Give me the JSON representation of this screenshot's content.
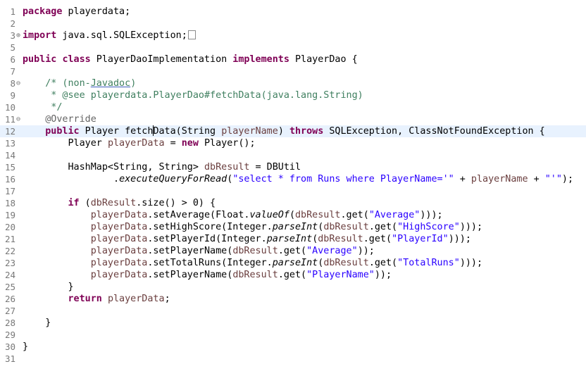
{
  "editor": {
    "current_line": 12,
    "lines": [
      {
        "n": "1",
        "fold": "",
        "tokens": [
          {
            "t": "package",
            "c": "kw"
          },
          {
            "t": " playerdata;"
          }
        ]
      },
      {
        "n": "2",
        "fold": "",
        "tokens": []
      },
      {
        "n": "3",
        "fold": "⊕",
        "tokens": [
          {
            "t": "import",
            "c": "kw"
          },
          {
            "t": " java.sql.SQLException;"
          },
          {
            "box": true
          }
        ]
      },
      {
        "n": "5",
        "fold": "",
        "tokens": []
      },
      {
        "n": "6",
        "fold": "",
        "tokens": [
          {
            "t": "public",
            "c": "kw"
          },
          {
            "t": " "
          },
          {
            "t": "class",
            "c": "kw"
          },
          {
            "t": " PlayerDaoImplementation "
          },
          {
            "t": "implements",
            "c": "kw"
          },
          {
            "t": " PlayerDao {"
          }
        ]
      },
      {
        "n": "7",
        "fold": "",
        "tokens": []
      },
      {
        "n": "8",
        "fold": "⊖",
        "tokens": [
          {
            "t": "    "
          },
          {
            "t": "/* (non-",
            "c": "cm"
          },
          {
            "t": "Javadoc",
            "c": "cm ul"
          },
          {
            "t": ")",
            "c": "cm"
          }
        ]
      },
      {
        "n": "9",
        "fold": "",
        "tokens": [
          {
            "t": "     * @see playerdata.PlayerDao#fetchData(java.lang.String)",
            "c": "cm"
          }
        ]
      },
      {
        "n": "10",
        "fold": "",
        "tokens": [
          {
            "t": "     */",
            "c": "cm"
          }
        ]
      },
      {
        "n": "11",
        "fold": "⊖",
        "tokens": [
          {
            "t": "    "
          },
          {
            "t": "@Override",
            "c": "ann"
          }
        ]
      },
      {
        "n": "12",
        "fold": "",
        "tokens": [
          {
            "t": "    "
          },
          {
            "t": "public",
            "c": "kw"
          },
          {
            "t": " Player fetch"
          },
          {
            "caret": true
          },
          {
            "t": "Data(String "
          },
          {
            "t": "playerName",
            "c": "fld"
          },
          {
            "t": ") "
          },
          {
            "t": "throws",
            "c": "kw"
          },
          {
            "t": " SQLException, ClassNotFoundException {"
          }
        ]
      },
      {
        "n": "13",
        "fold": "",
        "tokens": [
          {
            "t": "        Player "
          },
          {
            "t": "playerData",
            "c": "fld"
          },
          {
            "t": " = "
          },
          {
            "t": "new",
            "c": "kw"
          },
          {
            "t": " Player();"
          }
        ]
      },
      {
        "n": "14",
        "fold": "",
        "tokens": []
      },
      {
        "n": "15",
        "fold": "",
        "tokens": [
          {
            "t": "        HashMap<String, String> "
          },
          {
            "t": "dbResult",
            "c": "fld"
          },
          {
            "t": " = DBUtil"
          }
        ]
      },
      {
        "n": "16",
        "fold": "",
        "tokens": [
          {
            "t": "                ."
          },
          {
            "t": "executeQueryForRead",
            "c": "it"
          },
          {
            "t": "("
          },
          {
            "t": "\"select * from Runs where PlayerName='\"",
            "c": "str"
          },
          {
            "t": " + "
          },
          {
            "t": "playerName",
            "c": "fld"
          },
          {
            "t": " + "
          },
          {
            "t": "\"'\"",
            "c": "str"
          },
          {
            "t": ");"
          }
        ]
      },
      {
        "n": "17",
        "fold": "",
        "tokens": []
      },
      {
        "n": "18",
        "fold": "",
        "tokens": [
          {
            "t": "        "
          },
          {
            "t": "if",
            "c": "kw"
          },
          {
            "t": " ("
          },
          {
            "t": "dbResult",
            "c": "fld"
          },
          {
            "t": ".size() > 0) {"
          }
        ]
      },
      {
        "n": "19",
        "fold": "",
        "tokens": [
          {
            "t": "            "
          },
          {
            "t": "playerData",
            "c": "fld"
          },
          {
            "t": ".setAverage(Float."
          },
          {
            "t": "valueOf",
            "c": "it"
          },
          {
            "t": "("
          },
          {
            "t": "dbResult",
            "c": "fld"
          },
          {
            "t": ".get("
          },
          {
            "t": "\"Average\"",
            "c": "str"
          },
          {
            "t": ")));"
          }
        ]
      },
      {
        "n": "20",
        "fold": "",
        "tokens": [
          {
            "t": "            "
          },
          {
            "t": "playerData",
            "c": "fld"
          },
          {
            "t": ".setHighScore(Integer."
          },
          {
            "t": "parseInt",
            "c": "it"
          },
          {
            "t": "("
          },
          {
            "t": "dbResult",
            "c": "fld"
          },
          {
            "t": ".get("
          },
          {
            "t": "\"HighScore\"",
            "c": "str"
          },
          {
            "t": ")));"
          }
        ]
      },
      {
        "n": "21",
        "fold": "",
        "tokens": [
          {
            "t": "            "
          },
          {
            "t": "playerData",
            "c": "fld"
          },
          {
            "t": ".setPlayerId(Integer."
          },
          {
            "t": "parseInt",
            "c": "it"
          },
          {
            "t": "("
          },
          {
            "t": "dbResult",
            "c": "fld"
          },
          {
            "t": ".get("
          },
          {
            "t": "\"PlayerId\"",
            "c": "str"
          },
          {
            "t": ")));"
          }
        ]
      },
      {
        "n": "22",
        "fold": "",
        "tokens": [
          {
            "t": "            "
          },
          {
            "t": "playerData",
            "c": "fld"
          },
          {
            "t": ".setPlayerName("
          },
          {
            "t": "dbResult",
            "c": "fld"
          },
          {
            "t": ".get("
          },
          {
            "t": "\"Average\"",
            "c": "str"
          },
          {
            "t": "));"
          }
        ]
      },
      {
        "n": "23",
        "fold": "",
        "tokens": [
          {
            "t": "            "
          },
          {
            "t": "playerData",
            "c": "fld"
          },
          {
            "t": ".setTotalRuns(Integer."
          },
          {
            "t": "parseInt",
            "c": "it"
          },
          {
            "t": "("
          },
          {
            "t": "dbResult",
            "c": "fld"
          },
          {
            "t": ".get("
          },
          {
            "t": "\"TotalRuns\"",
            "c": "str"
          },
          {
            "t": ")));"
          }
        ]
      },
      {
        "n": "24",
        "fold": "",
        "tokens": [
          {
            "t": "            "
          },
          {
            "t": "playerData",
            "c": "fld"
          },
          {
            "t": ".setPlayerName("
          },
          {
            "t": "dbResult",
            "c": "fld"
          },
          {
            "t": ".get("
          },
          {
            "t": "\"PlayerName\"",
            "c": "str"
          },
          {
            "t": "));"
          }
        ]
      },
      {
        "n": "25",
        "fold": "",
        "tokens": [
          {
            "t": "        }"
          }
        ]
      },
      {
        "n": "26",
        "fold": "",
        "tokens": [
          {
            "t": "        "
          },
          {
            "t": "return",
            "c": "kw"
          },
          {
            "t": " "
          },
          {
            "t": "playerData",
            "c": "fld"
          },
          {
            "t": ";"
          }
        ]
      },
      {
        "n": "27",
        "fold": "",
        "tokens": []
      },
      {
        "n": "28",
        "fold": "",
        "tokens": [
          {
            "t": "    }"
          }
        ]
      },
      {
        "n": "29",
        "fold": "",
        "tokens": []
      },
      {
        "n": "30",
        "fold": "",
        "tokens": [
          {
            "t": "}"
          }
        ]
      },
      {
        "n": "31",
        "fold": "",
        "tokens": []
      }
    ]
  }
}
